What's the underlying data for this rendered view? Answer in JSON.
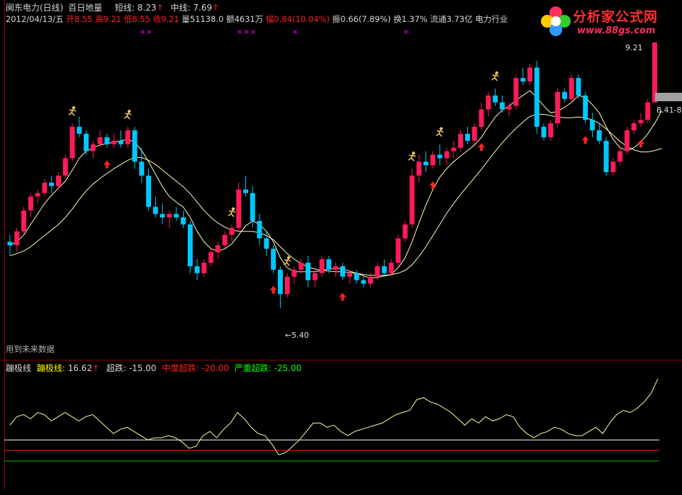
{
  "header": {
    "stock_name": "闽东电力(日线)",
    "indicator_name": "百日地量",
    "short_label": "短线:",
    "short_value": "8.23",
    "mid_label": "中线:",
    "mid_value": "7.69",
    "up_arrow": "↑",
    "date": "2012/04/13/五",
    "open_label": "开",
    "open_value": "8.55",
    "high_label": "高",
    "high_value": "9.21",
    "low_label": "低",
    "low_value": "8.55",
    "close_label": "收",
    "close_value": "9.21",
    "volume_label": "量",
    "volume_value": "51138.0",
    "amount_label": "额",
    "amount_value": "4631万",
    "change_label": "幅",
    "change_value": "0.84(10.04%)",
    "amplitude_label": "振",
    "amplitude_value": "0.66(7.89%)",
    "turnover_label": "换",
    "turnover_value": "1.37%",
    "float_label": "流通",
    "float_value": "3.73亿",
    "industry": "电力行业"
  },
  "logo": {
    "name": "分析家公式网",
    "url": "www.88gs.com"
  },
  "main_chart": {
    "high_tag": "9.21",
    "low_tag": "←5.40",
    "right_tag": "8.41-8",
    "future_note": "用到未来数据",
    "colors": {
      "up": "#ff1a5a",
      "down": "#00c8ff",
      "ma": "#ffffc0"
    }
  },
  "oscillator": {
    "title": "蹦极线",
    "line_label": "蹦极线:",
    "line_value": "16.62",
    "oversold_label": "超跌:",
    "oversold_value": "-15.00",
    "mid_oversold_label": "中度超跌:",
    "mid_oversold_value": "-20.00",
    "severe_label": "严重超跌:",
    "severe_value": "-25.00"
  },
  "chart_data": [
    {
      "type": "candlestick",
      "title": "闽东电力(日线)",
      "candles": [
        [
          6.35,
          6.45,
          6.15,
          6.3
        ],
        [
          6.3,
          6.55,
          6.2,
          6.5
        ],
        [
          6.5,
          6.85,
          6.45,
          6.8
        ],
        [
          6.8,
          7.05,
          6.7,
          7.0
        ],
        [
          7.0,
          7.1,
          6.9,
          7.05
        ],
        [
          7.05,
          7.25,
          7.0,
          7.2
        ],
        [
          7.2,
          7.3,
          7.05,
          7.15
        ],
        [
          7.15,
          7.35,
          7.1,
          7.3
        ],
        [
          7.3,
          7.6,
          7.25,
          7.55
        ],
        [
          7.55,
          8.05,
          7.5,
          8.0
        ],
        [
          8.0,
          8.15,
          7.85,
          7.9
        ],
        [
          7.9,
          7.95,
          7.6,
          7.65
        ],
        [
          7.65,
          7.8,
          7.55,
          7.75
        ],
        [
          7.75,
          7.95,
          7.7,
          7.85
        ],
        [
          7.85,
          7.9,
          7.7,
          7.75
        ],
        [
          7.75,
          7.9,
          7.7,
          7.8
        ],
        [
          7.8,
          7.95,
          7.7,
          7.75
        ],
        [
          7.75,
          8.0,
          7.7,
          7.95
        ],
        [
          7.95,
          8.0,
          7.4,
          7.5
        ],
        [
          7.5,
          7.7,
          7.2,
          7.3
        ],
        [
          7.3,
          7.4,
          6.8,
          6.85
        ],
        [
          6.85,
          7.0,
          6.7,
          6.75
        ],
        [
          6.75,
          6.9,
          6.6,
          6.7
        ],
        [
          6.7,
          6.8,
          6.55,
          6.75
        ],
        [
          6.75,
          6.85,
          6.65,
          6.7
        ],
        [
          6.7,
          6.8,
          6.55,
          6.6
        ],
        [
          6.6,
          6.65,
          5.9,
          6.0
        ],
        [
          6.0,
          6.1,
          5.8,
          5.9
        ],
        [
          5.9,
          6.1,
          5.85,
          6.05
        ],
        [
          6.05,
          6.25,
          6.0,
          6.2
        ],
        [
          6.2,
          6.35,
          6.1,
          6.3
        ],
        [
          6.3,
          6.5,
          6.25,
          6.45
        ],
        [
          6.45,
          6.6,
          6.35,
          6.55
        ],
        [
          6.55,
          7.2,
          6.5,
          7.1
        ],
        [
          7.1,
          7.3,
          7.0,
          7.05
        ],
        [
          7.05,
          7.15,
          6.55,
          6.65
        ],
        [
          6.65,
          6.75,
          6.3,
          6.4
        ],
        [
          6.4,
          6.5,
          6.15,
          6.25
        ],
        [
          6.25,
          6.3,
          5.9,
          5.95
        ],
        [
          5.95,
          6.0,
          5.4,
          5.6
        ],
        [
          5.6,
          5.9,
          5.55,
          5.85
        ],
        [
          5.85,
          6.0,
          5.75,
          5.95
        ],
        [
          5.95,
          6.1,
          5.9,
          6.05
        ],
        [
          6.05,
          6.15,
          5.7,
          5.8
        ],
        [
          5.8,
          5.95,
          5.7,
          5.9
        ],
        [
          5.9,
          6.15,
          5.85,
          6.1
        ],
        [
          6.1,
          6.15,
          5.9,
          5.95
        ],
        [
          5.95,
          6.05,
          5.85,
          6.0
        ],
        [
          6.0,
          6.05,
          5.8,
          5.85
        ],
        [
          5.85,
          5.95,
          5.75,
          5.9
        ],
        [
          5.9,
          5.95,
          5.75,
          5.8
        ],
        [
          5.8,
          5.85,
          5.7,
          5.75
        ],
        [
          5.75,
          5.9,
          5.7,
          5.85
        ],
        [
          5.85,
          6.05,
          5.8,
          6.0
        ],
        [
          6.0,
          6.1,
          5.85,
          5.9
        ],
        [
          5.9,
          6.1,
          5.85,
          6.05
        ],
        [
          6.05,
          6.45,
          6.0,
          6.4
        ],
        [
          6.4,
          6.65,
          6.35,
          6.6
        ],
        [
          6.6,
          7.4,
          6.55,
          7.3
        ],
        [
          7.3,
          7.6,
          7.2,
          7.5
        ],
        [
          7.5,
          7.65,
          7.35,
          7.45
        ],
        [
          7.45,
          7.65,
          7.4,
          7.6
        ],
        [
          7.6,
          7.75,
          7.45,
          7.55
        ],
        [
          7.55,
          7.7,
          7.45,
          7.65
        ],
        [
          7.65,
          7.8,
          7.55,
          7.7
        ],
        [
          7.7,
          7.95,
          7.65,
          7.9
        ],
        [
          7.9,
          8.0,
          7.75,
          7.8
        ],
        [
          7.8,
          8.05,
          7.75,
          8.0
        ],
        [
          8.0,
          8.35,
          7.95,
          8.25
        ],
        [
          8.25,
          8.5,
          8.15,
          8.45
        ],
        [
          8.45,
          8.55,
          8.3,
          8.35
        ],
        [
          8.35,
          8.45,
          8.2,
          8.25
        ],
        [
          8.25,
          8.35,
          8.15,
          8.3
        ],
        [
          8.3,
          8.75,
          8.25,
          8.7
        ],
        [
          8.7,
          8.85,
          8.6,
          8.65
        ],
        [
          8.65,
          8.9,
          8.6,
          8.85
        ],
        [
          8.85,
          8.95,
          7.9,
          8.0
        ],
        [
          8.0,
          8.05,
          7.8,
          7.85
        ],
        [
          7.85,
          8.1,
          7.8,
          8.05
        ],
        [
          8.05,
          8.55,
          8.0,
          8.5
        ],
        [
          8.5,
          8.55,
          8.35,
          8.4
        ],
        [
          8.4,
          8.75,
          8.35,
          8.7
        ],
        [
          8.7,
          8.75,
          8.4,
          8.45
        ],
        [
          8.45,
          8.5,
          8.05,
          8.1
        ],
        [
          8.1,
          8.2,
          7.85,
          7.95
        ],
        [
          7.95,
          8.05,
          7.75,
          7.8
        ],
        [
          7.8,
          7.85,
          7.3,
          7.35
        ],
        [
          7.35,
          7.55,
          7.3,
          7.5
        ],
        [
          7.5,
          7.7,
          7.45,
          7.65
        ],
        [
          7.65,
          8.0,
          7.6,
          7.95
        ],
        [
          7.95,
          8.1,
          7.9,
          8.05
        ],
        [
          8.05,
          8.2,
          8.0,
          8.1
        ],
        [
          8.1,
          8.4,
          8.05,
          8.35
        ],
        [
          8.35,
          9.21,
          8.35,
          9.21
        ]
      ],
      "ma_short": [
        6.3,
        6.35,
        6.45,
        6.6,
        6.75,
        6.9,
        7.02,
        7.12,
        7.22,
        7.38,
        7.55,
        7.65,
        7.7,
        7.74,
        7.76,
        7.78,
        7.8,
        7.82,
        7.78,
        7.66,
        7.5,
        7.32,
        7.14,
        7.0,
        6.92,
        6.85,
        6.7,
        6.5,
        6.35,
        6.25,
        6.22,
        6.25,
        6.32,
        6.45,
        6.58,
        6.65,
        6.6,
        6.5,
        6.35,
        6.12,
        5.98,
        5.92,
        5.92,
        5.92,
        5.92,
        5.94,
        5.96,
        5.97,
        5.96,
        5.93,
        5.9,
        5.86,
        5.83,
        5.84,
        5.86,
        5.88,
        5.98,
        6.12,
        6.35,
        6.62,
        6.88,
        7.1,
        7.28,
        7.4,
        7.5,
        7.58,
        7.66,
        7.74,
        7.85,
        8.0,
        8.14,
        8.24,
        8.3,
        8.38,
        8.45,
        8.52,
        8.42,
        8.3,
        8.2,
        8.22,
        8.28,
        8.35,
        8.45,
        8.42,
        8.32,
        8.2,
        8.0,
        7.82,
        7.7,
        7.66,
        7.7,
        7.78,
        7.9,
        8.05,
        8.23
      ],
      "ma_mid": [
        6.15,
        6.18,
        6.22,
        6.28,
        6.36,
        6.44,
        6.52,
        6.6,
        6.7,
        6.82,
        6.96,
        7.08,
        7.18,
        7.26,
        7.33,
        7.4,
        7.46,
        7.52,
        7.56,
        7.56,
        7.52,
        7.46,
        7.38,
        7.3,
        7.22,
        7.14,
        7.04,
        6.92,
        6.8,
        6.7,
        6.62,
        6.56,
        6.52,
        6.5,
        6.5,
        6.5,
        6.48,
        6.44,
        6.38,
        6.28,
        6.18,
        6.1,
        6.04,
        5.99,
        5.96,
        5.94,
        5.93,
        5.92,
        5.92,
        5.91,
        5.9,
        5.88,
        5.87,
        5.87,
        5.87,
        5.88,
        5.9,
        5.94,
        6.02,
        6.14,
        6.28,
        6.44,
        6.6,
        6.76,
        6.9,
        7.03,
        7.15,
        7.27,
        7.39,
        7.52,
        7.65,
        7.77,
        7.88,
        7.98,
        8.07,
        8.15,
        8.18,
        8.18,
        8.16,
        8.14,
        8.13,
        8.13,
        8.14,
        8.13,
        8.1,
        8.05,
        7.97,
        7.88,
        7.79,
        7.72,
        7.67,
        7.64,
        7.64,
        7.66,
        7.69
      ],
      "up_arrows_at": [
        14,
        38,
        48,
        61,
        68,
        83,
        91
      ],
      "runner_icons_at": [
        9,
        17,
        32,
        40,
        58,
        62,
        70
      ],
      "magenta_marks_at": [
        19,
        20,
        33,
        34,
        35,
        41,
        57
      ]
    },
    {
      "type": "line",
      "title": "蹦极线",
      "values": [
        -8,
        -4,
        -3,
        -5,
        -2,
        -3,
        -6,
        -4,
        -2,
        -4,
        -6,
        -4,
        -3,
        -6,
        -9,
        -12,
        -10,
        -9,
        -11,
        -13,
        -15,
        -14,
        -14,
        -13,
        -14,
        -16,
        -19,
        -18,
        -13,
        -11,
        -14,
        -10,
        -7,
        -2,
        -5,
        -9,
        -12,
        -13,
        -17,
        -22,
        -21,
        -18,
        -15,
        -11,
        -7,
        -7,
        -9,
        -8,
        -11,
        -13,
        -11,
        -10,
        -9,
        -8,
        -7,
        -5,
        -3,
        -2,
        -1,
        4,
        5,
        3,
        2,
        0,
        -2,
        -5,
        -8,
        -5,
        -7,
        -4,
        -6,
        -5,
        -3,
        -4,
        -9,
        -12,
        -14,
        -12,
        -11,
        -9,
        -10,
        -12,
        -13,
        -13,
        -11,
        -9,
        -12,
        -7,
        -3,
        -1,
        -2,
        0,
        3,
        7,
        14
      ],
      "levels": [
        -15,
        -20,
        -25
      ]
    }
  ]
}
